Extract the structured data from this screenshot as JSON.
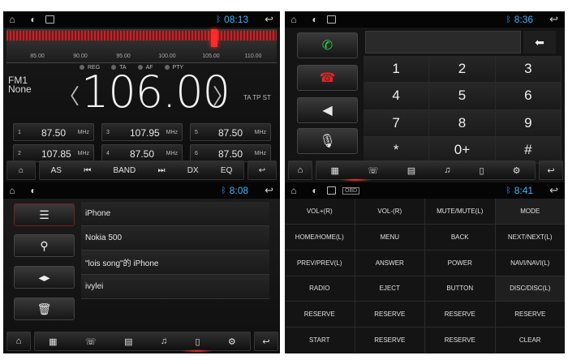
{
  "radio": {
    "status": {
      "time": "08:13",
      "home_icon": "home-icon",
      "back_icon": "back-icon"
    },
    "scale": [
      "85.00",
      "90.00",
      "95.00",
      "100.00",
      "105.00",
      "110.00"
    ],
    "rds_flags": [
      "REG",
      "TA",
      "AF",
      "PTY"
    ],
    "band": "FM1",
    "station_name": "None",
    "frequency": "106.00",
    "ta_flags": "TA TP ST",
    "presets": [
      {
        "num": "1",
        "freq": "87.50",
        "unit": "MHz"
      },
      {
        "num": "3",
        "freq": "107.95",
        "unit": "MHz"
      },
      {
        "num": "5",
        "freq": "87.50",
        "unit": "MHz"
      },
      {
        "num": "2",
        "freq": "107.85",
        "unit": "MHz"
      },
      {
        "num": "4",
        "freq": "87.50",
        "unit": "MHz"
      },
      {
        "num": "6",
        "freq": "87.50",
        "unit": "MHz"
      }
    ],
    "bar": {
      "as": "AS",
      "band": "BAND",
      "dx": "DX",
      "eq": "EQ"
    }
  },
  "phone": {
    "status": {
      "time": "8:36"
    },
    "keys": [
      "1",
      "2",
      "3",
      "4",
      "5",
      "6",
      "7",
      "8",
      "9",
      "*",
      "0+",
      "#"
    ]
  },
  "bluetooth": {
    "status": {
      "time": "8:08"
    },
    "devices": [
      "iPhone",
      "Nokia 500",
      "\"lois song\"的 iPhone",
      "ivylei"
    ]
  },
  "keys": {
    "status": {
      "time": "8:41"
    },
    "grid": [
      "VOL+(R)",
      "VOL-(R)",
      "MUTE/MUTE(L)",
      "MODE",
      "HOME/HOME(L)",
      "MENU",
      "BACK",
      "NEXT/NEXT(L)",
      "PREV/PREV(L)",
      "ANSWER",
      "POWER",
      "NAVI/NAVI(L)",
      "RADIO",
      "EJECT",
      "BUTTON",
      "DISC/DISC(L)",
      "RESERVE",
      "RESERVE",
      "RESERVE",
      "RESERVE",
      "START",
      "RESERVE",
      "RESERVE",
      "CLEAR"
    ]
  },
  "colors": {
    "accent_time": "#37b6ff",
    "needle": "#ff2a2a",
    "call_green": "#2bd24a",
    "hangup_red": "#e0242a"
  }
}
